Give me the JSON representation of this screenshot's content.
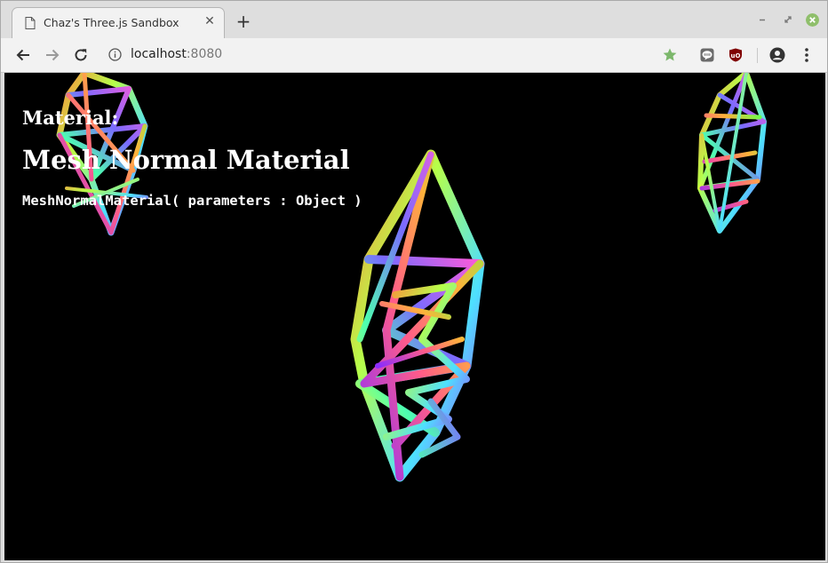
{
  "browser": {
    "tab": {
      "title": "Chaz's Three.js Sandbox",
      "icon": "file-icon",
      "close_glyph": "✕"
    },
    "new_tab_glyph": "+",
    "window_controls": [
      "minimize-icon",
      "maximize-icon",
      "close-icon"
    ],
    "address_bar": {
      "host": "localhost",
      "port": ":8080",
      "info_icon": "info-icon"
    },
    "toolbar_icons": [
      "back-arrow-icon",
      "forward-arrow-icon",
      "reload-icon",
      "star-icon",
      "line-extension-icon",
      "ublock-icon",
      "account-icon",
      "menu-icon"
    ],
    "colors": {
      "star": "#7cb76b",
      "window_close": "#8fbf6b",
      "ublock": "#800000"
    }
  },
  "page": {
    "background": "#000000",
    "heading_small": "Material:",
    "heading_large": "Mesh Normal Material",
    "signature": "MeshNormalMaterial( parameters : Object )",
    "scene_objects": [
      "wireframe-crystal-left",
      "wireframe-crystal-center",
      "wireframe-crystal-right"
    ]
  }
}
